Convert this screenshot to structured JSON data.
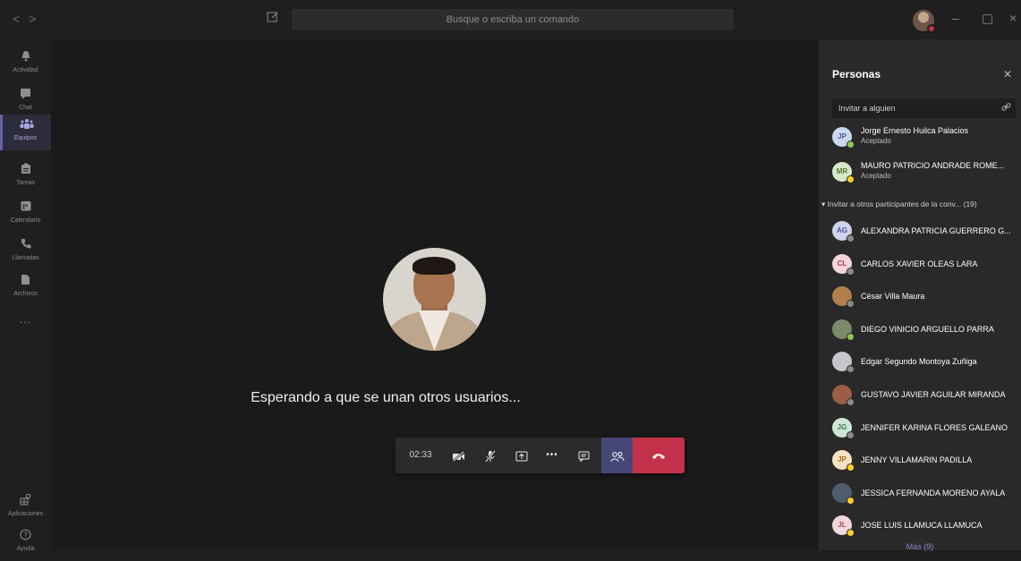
{
  "topbar": {
    "back": "<",
    "forward": ">",
    "search_placeholder": "Busque o escriba un comando",
    "minimize": "–",
    "maximize": "▢",
    "close": "×"
  },
  "rail": {
    "items": [
      {
        "label": "Actividad",
        "icon": "bell-icon"
      },
      {
        "label": "Chat",
        "icon": "chat-icon"
      },
      {
        "label": "Equipos",
        "icon": "teams-icon"
      },
      {
        "label": "Tareas",
        "icon": "tasks-icon"
      },
      {
        "label": "Calendario",
        "icon": "calendar-icon"
      },
      {
        "label": "Llamadas",
        "icon": "phone-icon"
      },
      {
        "label": "Archivos",
        "icon": "files-icon"
      },
      {
        "label": "...",
        "icon": "more-icon"
      }
    ],
    "apps_label": "Aplicaciones",
    "help_label": "Ayuda"
  },
  "stage": {
    "waiting_text": "Esperando a que se unan otros usuarios..."
  },
  "controls": {
    "timer": "02:33",
    "more": "•••"
  },
  "panel": {
    "title": "Personas",
    "invite_placeholder": "Invitar a alguien",
    "accepted": [
      {
        "initials": "JP",
        "name": "Jorge Ernesto Huilca Palacios",
        "status": "Aceptado",
        "avatar_bg": "#c9d8ee",
        "avatar_fg": "#4a5d8a",
        "dot": "#92c353"
      },
      {
        "initials": "MR",
        "name": "MAURO PATRICIO ANDRADE ROME...",
        "status": "Aceptado",
        "avatar_bg": "#d6e8c8",
        "avatar_fg": "#537a2d",
        "dot": "#f8d22a"
      }
    ],
    "section_label": "Invitar a otros participantes de la conv... (19)",
    "others": [
      {
        "initials": "AG",
        "name": "ALEXANDRA PATRICIA GUERRERO G...",
        "avatar_bg": "#cfd3ec",
        "avatar_fg": "#4b52a0",
        "dot": "#8a8a8a"
      },
      {
        "initials": "CL",
        "name": "CARLOS XAVIER OLEAS LARA",
        "avatar_bg": "#f2d6dc",
        "avatar_fg": "#a33a55",
        "dot": "#8a8a8a"
      },
      {
        "initials": "",
        "name": "César Villa Maura",
        "avatar_bg": "#b07f4c",
        "avatar_fg": "#fff",
        "dot": "#8a8a8a"
      },
      {
        "initials": "",
        "name": "DIEGO VINICIO ARGUELLO PARRA",
        "avatar_bg": "#7b8a6a",
        "avatar_fg": "#fff",
        "dot": "#92c353"
      },
      {
        "initials": "",
        "name": "Edgar Segundo Montoya Zuñiga",
        "avatar_bg": "#c4c6c9",
        "avatar_fg": "#fff",
        "dot": "#8a8a8a"
      },
      {
        "initials": "",
        "name": "GUSTAVO JAVIER AGUILAR MIRANDA",
        "avatar_bg": "#9a5d45",
        "avatar_fg": "#fff",
        "dot": "#8a8a8a"
      },
      {
        "initials": "JG",
        "name": "JENNIFER KARINA FLORES GALEANO",
        "avatar_bg": "#cfe6d7",
        "avatar_fg": "#3f7a55",
        "dot": "#8a8a8a"
      },
      {
        "initials": "JP",
        "name": "JENNY VILLAMARIN PADILLA",
        "avatar_bg": "#f6e2c3",
        "avatar_fg": "#a36a1c",
        "dot": "#f8d22a"
      },
      {
        "initials": "",
        "name": "JESSICA FERNANDA MORENO AYALA",
        "avatar_bg": "#4d5d6d",
        "avatar_fg": "#fff",
        "dot": "#f8d22a"
      },
      {
        "initials": "JL",
        "name": "JOSE LUIS LLAMUCA LLAMUCA",
        "avatar_bg": "#f0d8dd",
        "avatar_fg": "#9c4f5f",
        "dot": "#f8d22a"
      }
    ],
    "more_label": "Más (9)"
  }
}
